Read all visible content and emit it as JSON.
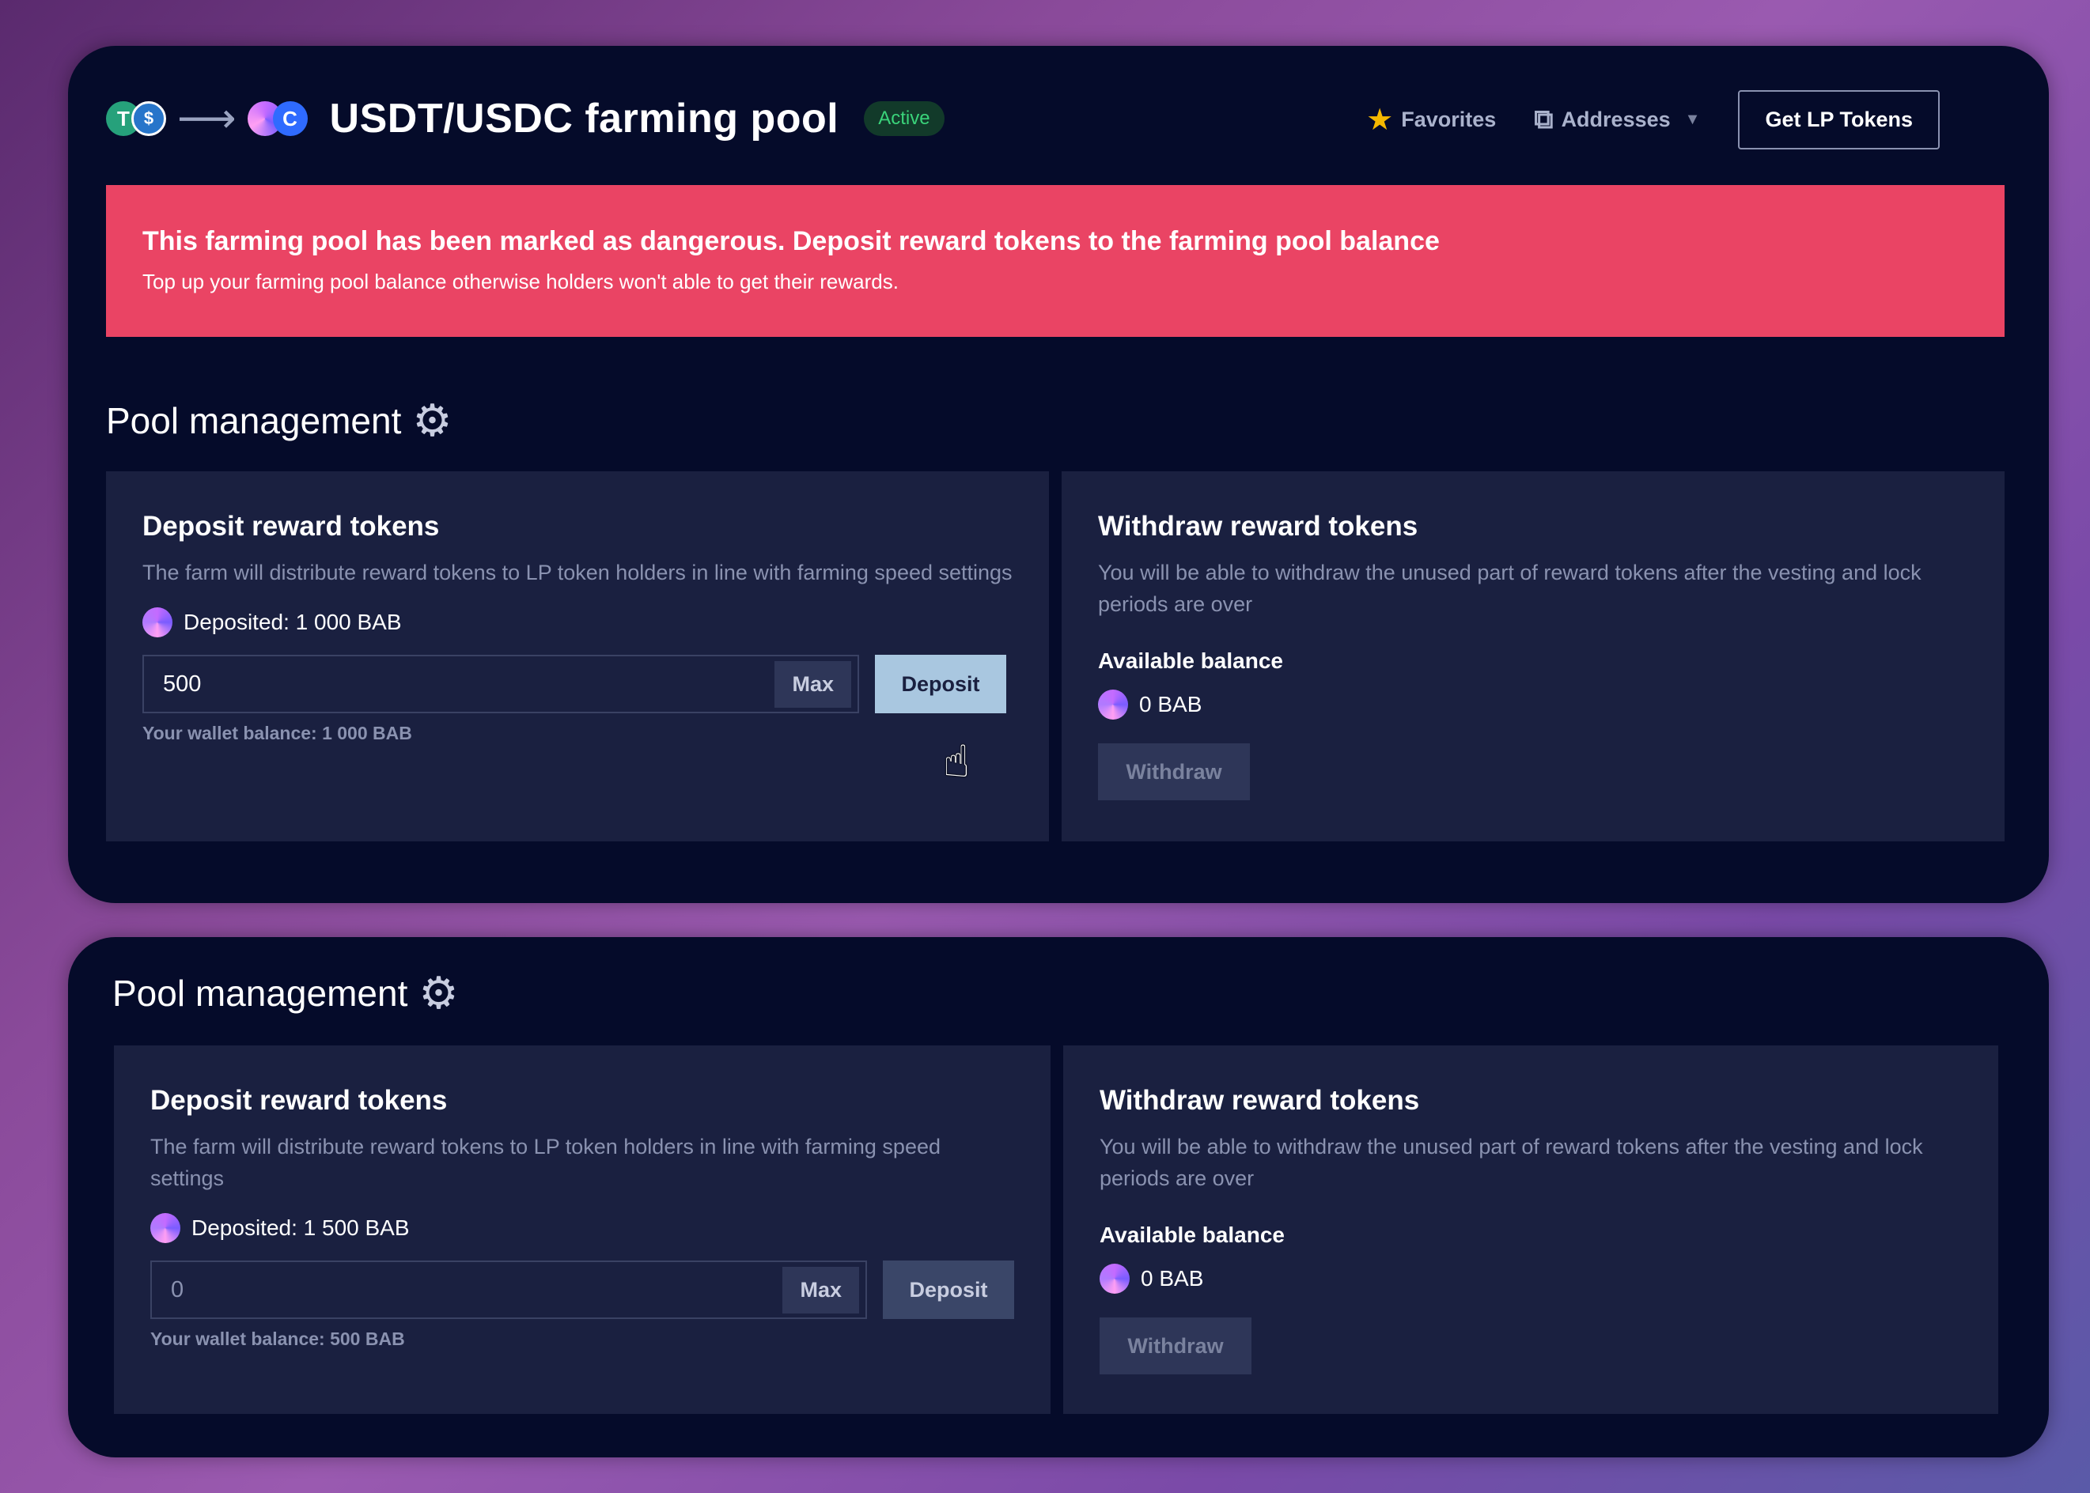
{
  "header": {
    "title": "USDT/USDC farming pool",
    "status": "Active",
    "favorites_label": "Favorites",
    "addresses_label": "Addresses",
    "get_lp_label": "Get LP Tokens"
  },
  "alert": {
    "title": "This farming pool has been marked as dangerous. Deposit reward tokens to the farming pool balance",
    "text": "Top up your farming pool balance otherwise holders won't able to get their rewards."
  },
  "sections": [
    {
      "title": "Pool management",
      "deposit": {
        "heading": "Deposit reward tokens",
        "description": "The farm will distribute reward tokens to LP token holders in line with farming speed settings",
        "deposited": "Deposited: 1 000 BAB",
        "input_value": "500",
        "max_label": "Max",
        "deposit_label": "Deposit",
        "wallet_balance": "Your wallet balance: 1 000 BAB"
      },
      "withdraw": {
        "heading": "Withdraw reward tokens",
        "description": "You will be able to withdraw the unused part of reward tokens after the vesting and lock periods are over",
        "available_label": "Available balance",
        "available_value": "0 BAB",
        "withdraw_label": "Withdraw"
      }
    },
    {
      "title": "Pool management",
      "deposit": {
        "heading": "Deposit reward tokens",
        "description": "The farm will distribute reward tokens to LP token holders in line with farming speed settings",
        "deposited": "Deposited: 1 500 BAB",
        "input_placeholder": "0",
        "max_label": "Max",
        "deposit_label": "Deposit",
        "wallet_balance": "Your wallet balance: 500 BAB"
      },
      "withdraw": {
        "heading": "Withdraw reward tokens",
        "description": "You will be able to withdraw the unused part of reward tokens after the vesting and lock periods are over",
        "available_label": "Available balance",
        "available_value": "0 BAB",
        "withdraw_label": "Withdraw"
      }
    }
  ],
  "colors": {
    "alert": "#ea4464",
    "card": "#050b2a",
    "panel": "#1a2040",
    "status_green": "#3ad37a"
  }
}
